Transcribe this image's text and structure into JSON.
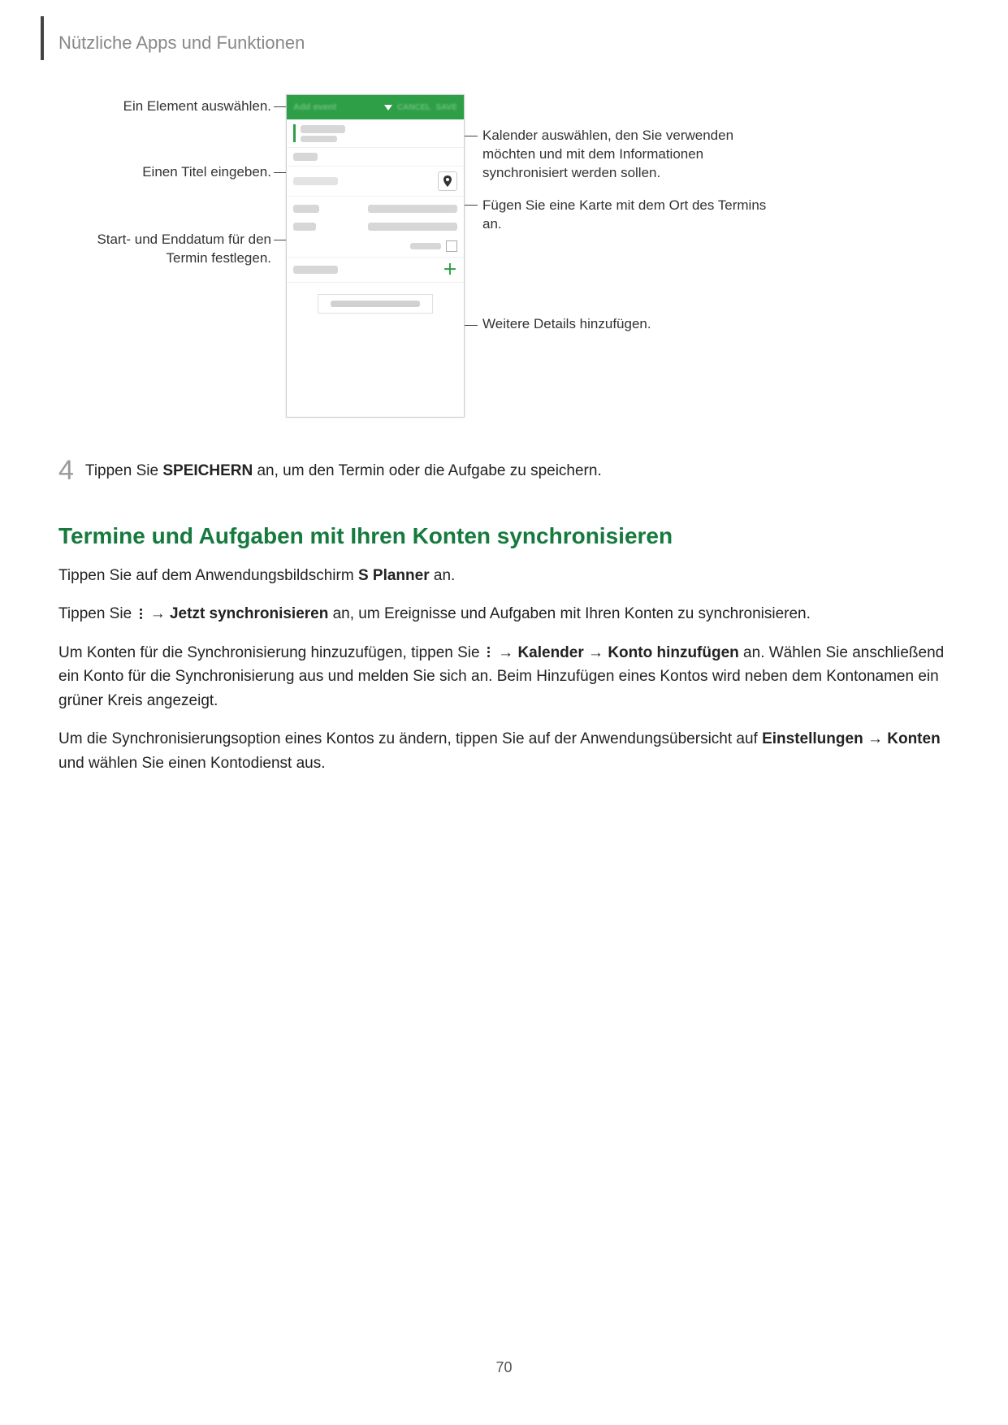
{
  "header": {
    "section": "Nützliche Apps und Funktionen"
  },
  "callouts": {
    "selectItem": "Ein Element auswählen.",
    "enterTitle": "Einen Titel eingeben.",
    "setDates": "Start- und Enddatum für den Termin festlegen.",
    "chooseCalendar": "Kalender auswählen, den Sie verwenden möchten und mit dem Informationen synchronisiert werden sollen.",
    "attachMap": "Fügen Sie eine Karte mit dem Ort des Termins an.",
    "moreDetails": "Weitere Details hinzufügen."
  },
  "step4": {
    "num": "4",
    "pre": "Tippen Sie ",
    "bold": "SPEICHERN",
    "post": " an, um den Termin oder die Aufgabe zu speichern."
  },
  "sync": {
    "heading": "Termine und Aufgaben mit Ihren Konten synchronisieren",
    "p1_pre": "Tippen Sie auf dem Anwendungsbildschirm ",
    "p1_bold": "S Planner",
    "p1_post": " an.",
    "p2_pre": "Tippen Sie ",
    "p2_arrow": " → ",
    "p2_bold": "Jetzt synchronisieren",
    "p2_post": " an, um Ereignisse und Aufgaben mit Ihren Konten zu synchronisieren.",
    "p3_pre": "Um Konten für die Synchronisierung hinzuzufügen, tippen Sie ",
    "p3_b1": "Kalender",
    "p3_b2": "Konto hinzufügen",
    "p3_post": " an. Wählen Sie anschließend ein Konto für die Synchronisierung aus und melden Sie sich an. Beim Hinzufügen eines Kontos wird neben dem Kontonamen ein grüner Kreis angezeigt.",
    "p4_pre": "Um die Synchronisierungsoption eines Kontos zu ändern, tippen Sie auf der Anwendungsübersicht auf ",
    "p4_b1": "Einstellungen",
    "p4_b2": "Konten",
    "p4_post": " und wählen Sie einen Kontodienst aus."
  },
  "pageNumber": "70"
}
